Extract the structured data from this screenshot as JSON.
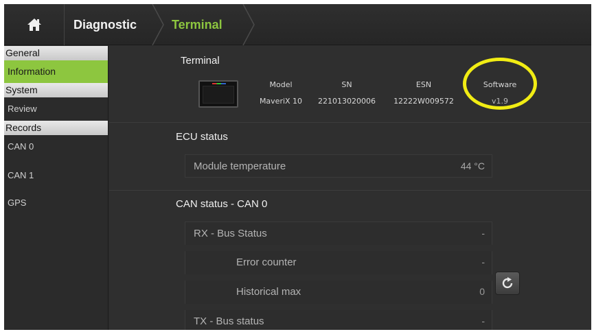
{
  "header": {
    "breadcrumbs": [
      "Diagnostic",
      "Terminal"
    ],
    "active_color": "#8dc63f"
  },
  "sidebar": {
    "groups": [
      {
        "heading": "General",
        "items": [
          "Information"
        ]
      },
      {
        "heading": "System",
        "items": [
          "Review"
        ]
      },
      {
        "heading": "Records",
        "items": [
          "CAN 0",
          "CAN 1",
          "GPS"
        ]
      }
    ],
    "active_item": "Information"
  },
  "terminal": {
    "title": "Terminal",
    "model_label": "Model",
    "model_value": "MaveriX 10",
    "sn_label": "SN",
    "sn_value": "221013020006",
    "esn_label": "ESN",
    "esn_value": "12222W009572",
    "software_label": "Software",
    "software_value": "v1.9",
    "highlight_color": "#f1ec14"
  },
  "ecu": {
    "title": "ECU status",
    "module_temp_label": "Module temperature",
    "module_temp_value": "44 °C"
  },
  "can": {
    "title": "CAN status - CAN 0",
    "rx_label": "RX - Bus Status",
    "rx_value": "-",
    "error_counter_label": "Error counter",
    "error_counter_value": "-",
    "historical_max_label": "Historical max",
    "historical_max_value": "0",
    "tx_label": "TX - Bus status",
    "tx_value": "-"
  }
}
